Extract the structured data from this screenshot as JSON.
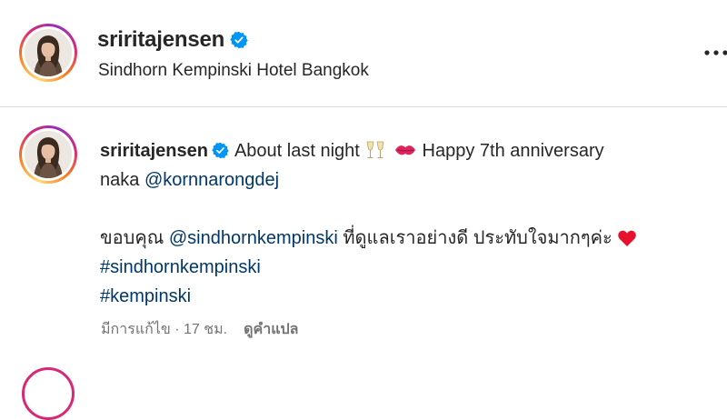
{
  "header": {
    "username": "sriritajensen",
    "location": "Sindhorn Kempinski Hotel Bangkok",
    "icons": {
      "verified": "verified-badge-icon",
      "more": "more-options-icon"
    }
  },
  "comment": {
    "username": "sriritajensen",
    "caption_line1": "About last night",
    "caption_line1b": "Happy 7th anniversary",
    "caption_line2_prefix": "naka",
    "mention1": "@kornnarongdej",
    "thai_prefix": "ขอบคุณ",
    "mention2": "@sindhornkempinski",
    "thai_suffix": "ที่ดูแลเราอย่างดี ประทับใจมากๆค่ะ",
    "hashtag1": "#sindhornkempinski",
    "hashtag2": "#kempinski",
    "meta": "มีการแก้ไข · 17 ชม.",
    "translate": "ดูคำแปล",
    "icons": [
      "champagne-icon",
      "kiss-icon",
      "red-heart-icon"
    ]
  },
  "colors": {
    "text": "#262626",
    "link": "#00376b",
    "meta": "#737373",
    "verified": "#0095f6",
    "divider": "#dbdbdb"
  }
}
